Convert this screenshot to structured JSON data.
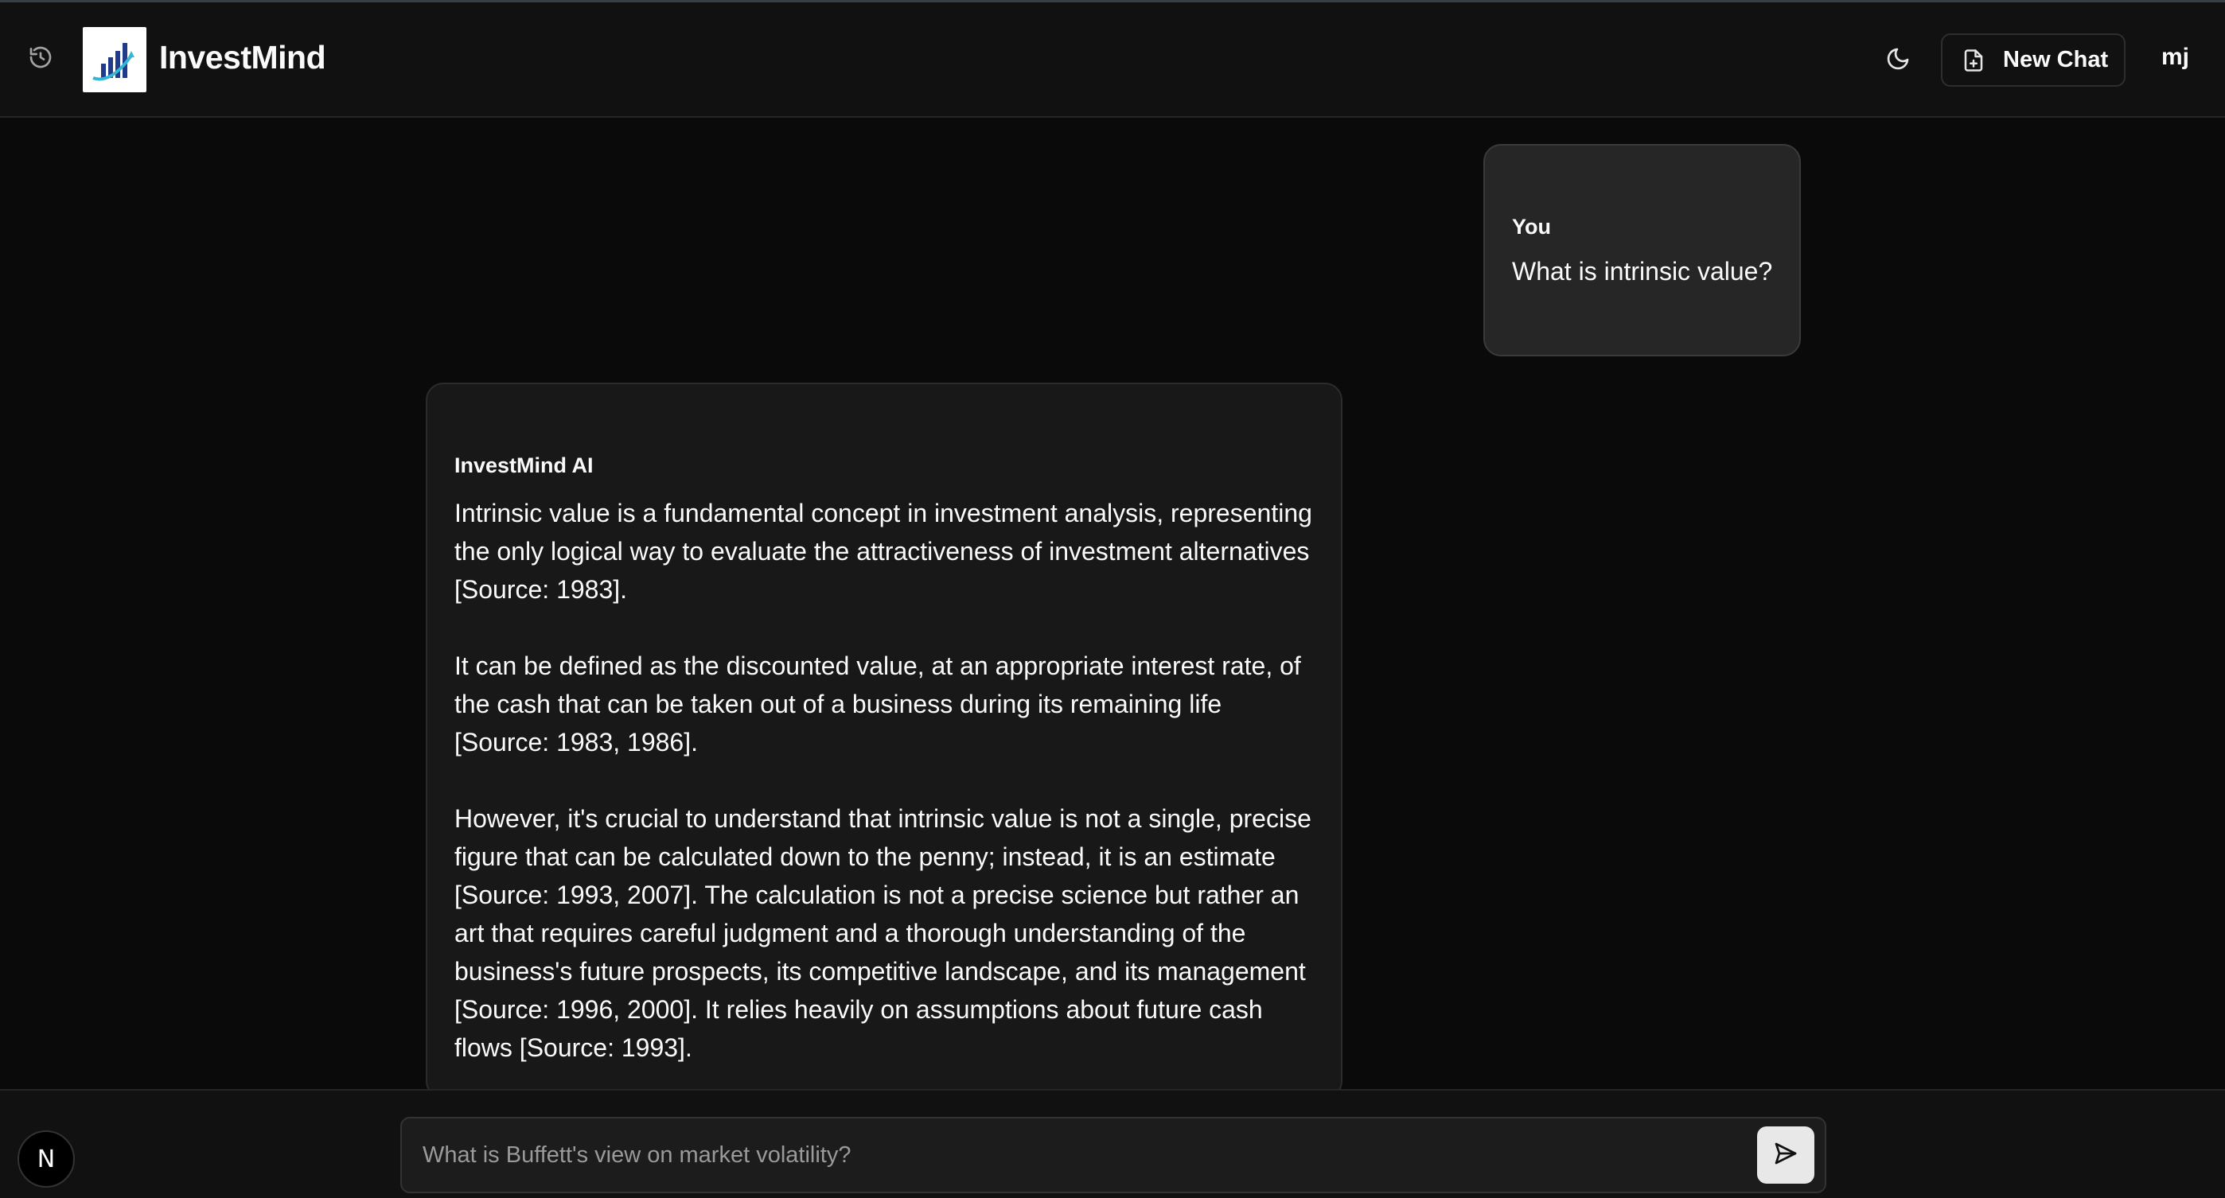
{
  "header": {
    "brand": "InvestMind",
    "new_chat_label": "New Chat",
    "user_initials": "mj",
    "icons": {
      "history": "history-icon",
      "logo": "bar-chart-logo",
      "theme": "moon-icon",
      "new_chat": "file-plus-icon"
    }
  },
  "messages": [
    {
      "sender": "You",
      "text": "What is intrinsic value?"
    },
    {
      "sender": "InvestMind AI",
      "paragraphs": [
        "Intrinsic value is a fundamental concept in investment analysis, representing the only logical way to evaluate the attractiveness of investment alternatives [Source: 1983].",
        "It can be defined as the discounted value, at an appropriate interest rate, of the cash that can be taken out of a business during its remaining life [Source: 1983, 1986].",
        "However, it's crucial to understand that intrinsic value is not a single, precise figure that can be calculated down to the penny; instead, it is an estimate [Source: 1993, 2007]. The calculation is not a precise science but rather an art that requires careful judgment and a thorough understanding of the business's future prospects, its competitive landscape, and its management [Source: 1996, 2000]. It relies heavily on assumptions about future cash flows [Source: 1993]."
      ]
    }
  ],
  "composer": {
    "placeholder": "What is Buffett's view on market volatility?",
    "value": ""
  },
  "footer": {
    "badge_letter": "N"
  },
  "colors": {
    "background": "#0a0a0a",
    "header": "#111111",
    "user_bubble": "#262626",
    "ai_bubble": "#181818",
    "send_button": "#e8e8e8"
  }
}
